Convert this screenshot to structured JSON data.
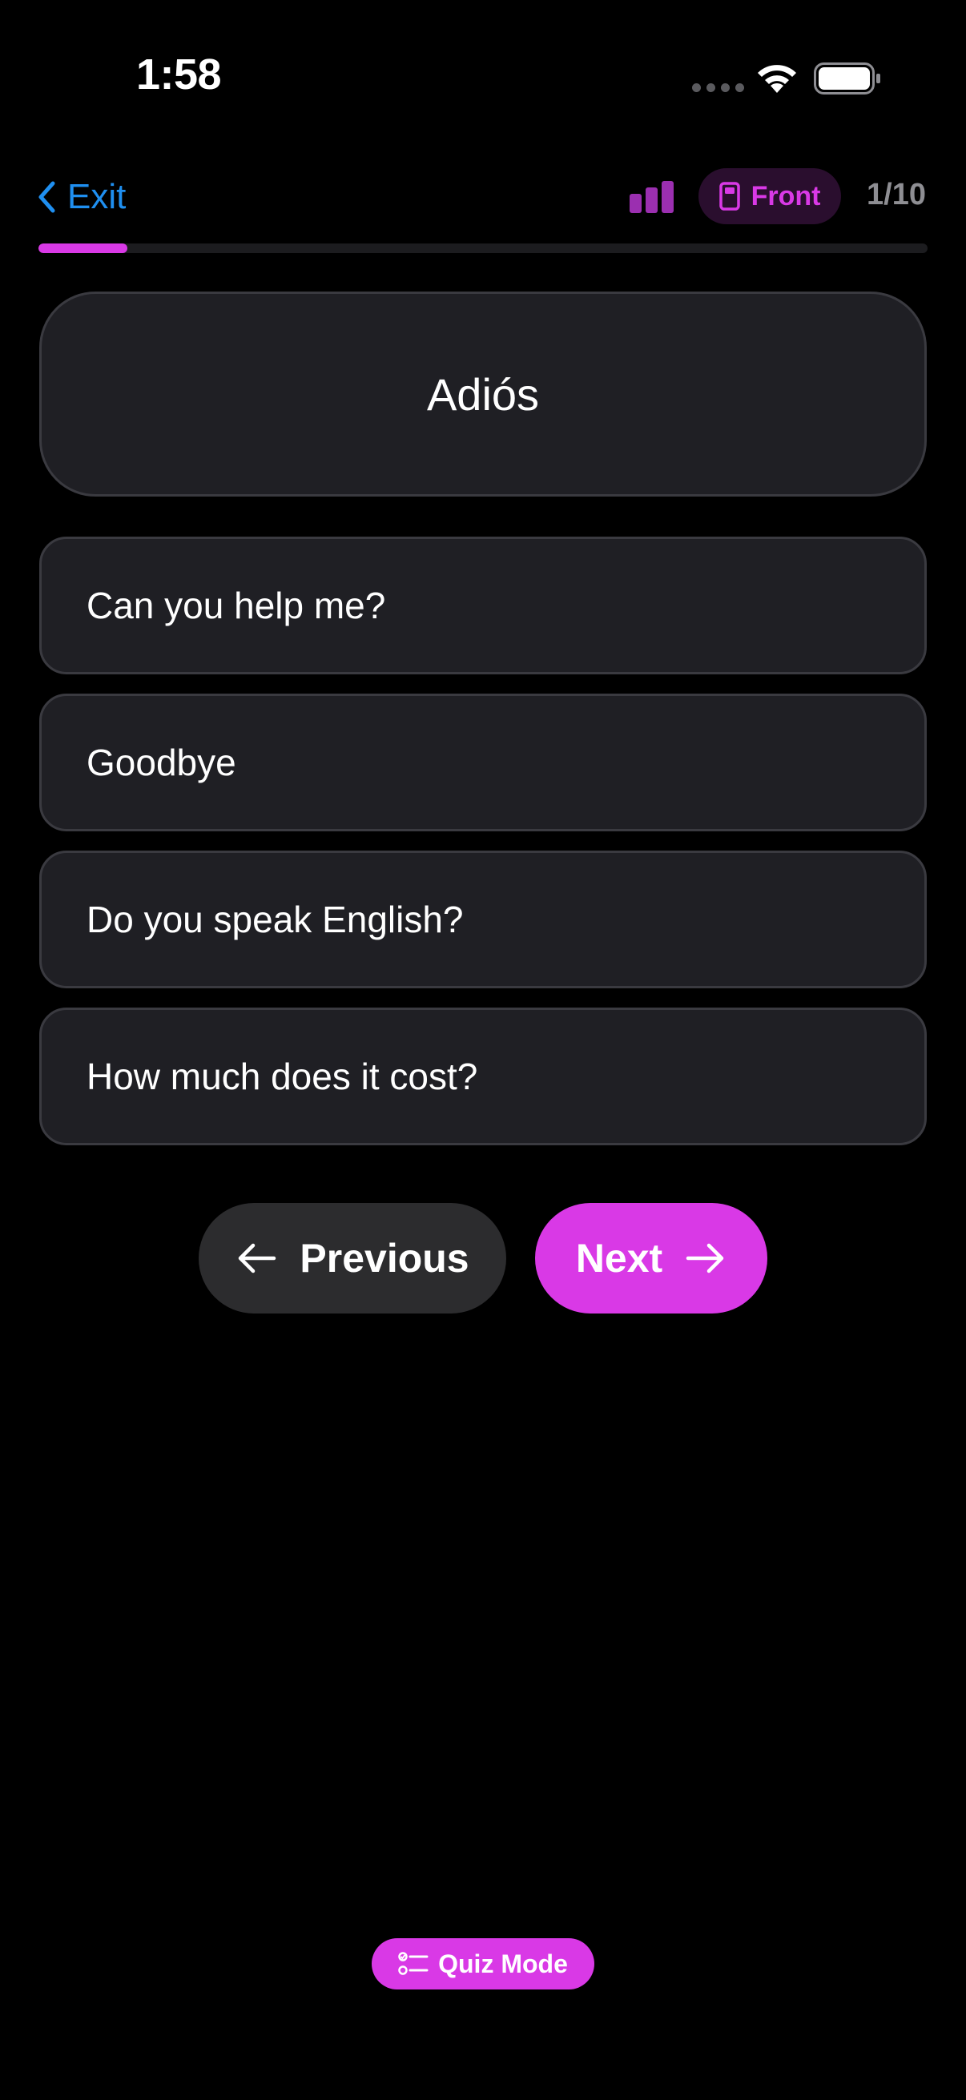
{
  "status_bar": {
    "time": "1:58"
  },
  "header": {
    "exit_label": "Exit",
    "side_label": "Front",
    "counter": "1/10",
    "progress": 0.1
  },
  "card": {
    "prompt": "Adiós"
  },
  "options": [
    {
      "label": "Can you help me?"
    },
    {
      "label": "Goodbye"
    },
    {
      "label": "Do you speak English?"
    },
    {
      "label": "How much does it cost?"
    }
  ],
  "navigation": {
    "previous_label": "Previous",
    "next_label": "Next"
  },
  "footer": {
    "quiz_mode_label": "Quiz Mode"
  },
  "icons": {
    "back": "chevron-left-icon",
    "level": "bar-level-icon",
    "side": "card-front-icon",
    "previous": "arrow-left-icon",
    "next": "arrow-right-icon",
    "quiz": "checklist-icon"
  },
  "colors": {
    "accent": "#d939e6",
    "link": "#1f8ff0",
    "background": "#000000",
    "card": "#1f1f24",
    "card_border": "#3a3a40",
    "muted": "#8e8e93"
  }
}
